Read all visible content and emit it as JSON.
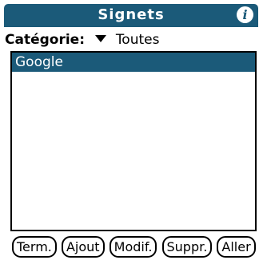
{
  "app": {
    "title": "Signets",
    "info_icon": "info-icon"
  },
  "category": {
    "label": "Catégorie:",
    "selected": "Toutes",
    "dropdown_icon": "triangle-down-icon"
  },
  "list": {
    "items": [
      {
        "label": "Google",
        "selected": true
      }
    ]
  },
  "buttons": {
    "done": "Term.",
    "add": "Ajout",
    "edit": "Modif.",
    "delete": "Suppr.",
    "go": "Aller"
  },
  "colors": {
    "accent": "#1b5a79",
    "background": "#ffffff",
    "text": "#000000"
  }
}
